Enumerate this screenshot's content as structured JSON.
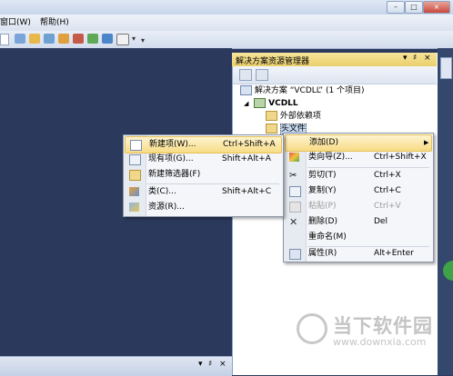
{
  "menubar": {
    "items": [
      "窗口(W)",
      "帮助(H)"
    ]
  },
  "solution_explorer": {
    "title": "解决方案资源管理器",
    "header_buttons": [
      "▾",
      "♯",
      "×"
    ],
    "tree": {
      "solution": "解决方案 “VCDLL” (1 个项目)",
      "project": "VCDLL",
      "external_deps": "外部依赖项",
      "header_files": "头文件"
    }
  },
  "context_menu": {
    "items": [
      {
        "label": "添加(D)",
        "shortcut": "",
        "icon": "none",
        "disabled": false,
        "highlighted": true,
        "submenu": true
      },
      {
        "label": "类向导(Z)...",
        "shortcut": "Ctrl+Shift+X",
        "icon": "wizard-icon",
        "disabled": false
      },
      {
        "label": "剪切(T)",
        "shortcut": "Ctrl+X",
        "icon": "cut-icon",
        "disabled": false
      },
      {
        "label": "复制(Y)",
        "shortcut": "Ctrl+C",
        "icon": "copy-icon",
        "disabled": false
      },
      {
        "label": "粘贴(P)",
        "shortcut": "Ctrl+V",
        "icon": "paste-icon",
        "disabled": true
      },
      {
        "label": "删除(D)",
        "shortcut": "Del",
        "icon": "delete-icon",
        "disabled": false
      },
      {
        "label": "重命名(M)",
        "shortcut": "",
        "icon": "none",
        "disabled": false
      },
      {
        "label": "属性(R)",
        "shortcut": "Alt+Enter",
        "icon": "properties-icon",
        "disabled": false
      }
    ]
  },
  "add_submenu": {
    "items": [
      {
        "label": "新建项(W)...",
        "shortcut": "Ctrl+Shift+A",
        "icon": "new-item-icon",
        "highlighted": true
      },
      {
        "label": "现有项(G)...",
        "shortcut": "Shift+Alt+A",
        "icon": "existing-item-icon"
      },
      {
        "label": "新建筛选器(F)",
        "shortcut": "",
        "icon": "folder-icon"
      },
      {
        "label": "类(C)...",
        "shortcut": "Shift+Alt+C",
        "icon": "class-icon"
      },
      {
        "label": "资源(R)...",
        "shortcut": "",
        "icon": "resource-icon"
      }
    ]
  },
  "bottom_panel": {
    "buttons": [
      "▾",
      "♯",
      "×"
    ]
  },
  "watermark": {
    "brand": "当下软件园",
    "url": "www.downxia.com"
  },
  "colors": {
    "accent": "#f8dc86",
    "editor_bg": "#2b3a5c",
    "panel_header": "#eacf6b"
  }
}
